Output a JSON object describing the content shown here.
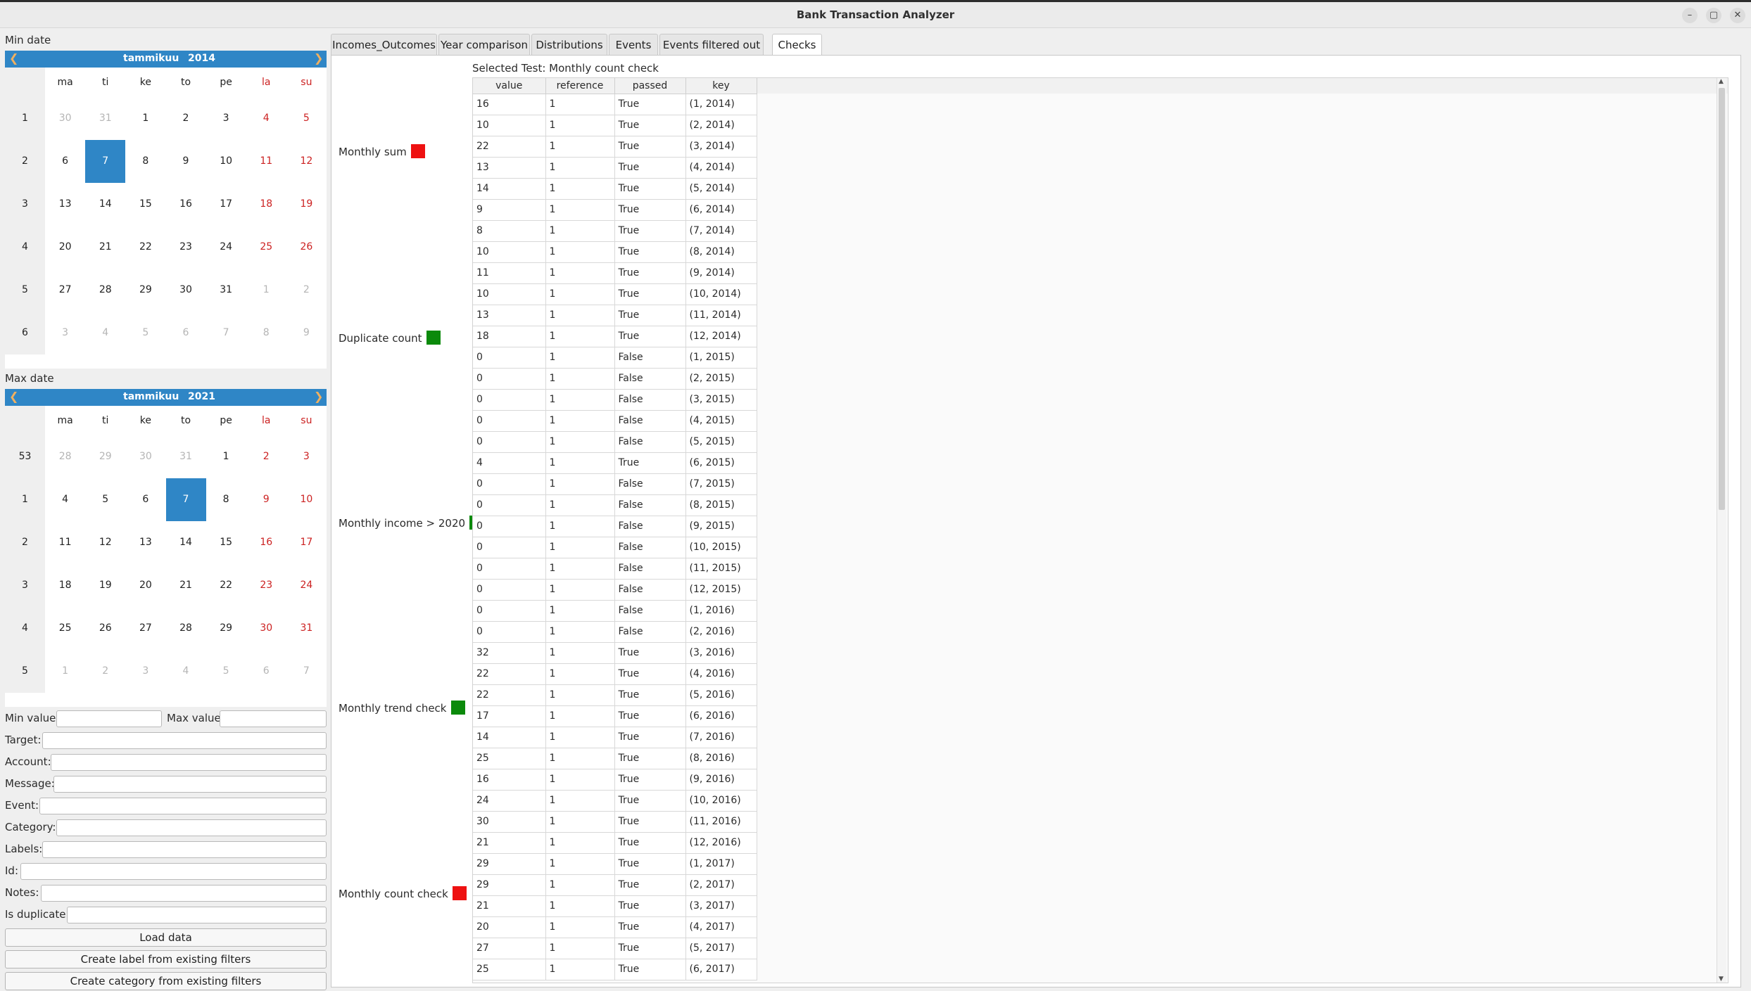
{
  "window": {
    "title": "Bank Transaction Analyzer",
    "minimize": "–",
    "maximize": "▢",
    "close": "✕"
  },
  "min_date": {
    "label": "Min date",
    "month": "tammikuu",
    "year": "2014",
    "day_headers": [
      "ma",
      "ti",
      "ke",
      "to",
      "pe",
      "la",
      "su"
    ],
    "weeks": [
      "1",
      "2",
      "3",
      "4",
      "5",
      "6"
    ],
    "days": [
      [
        "30",
        "31",
        "1",
        "2",
        "3",
        "4",
        "5"
      ],
      [
        "6",
        "7",
        "8",
        "9",
        "10",
        "11",
        "12"
      ],
      [
        "13",
        "14",
        "15",
        "16",
        "17",
        "18",
        "19"
      ],
      [
        "20",
        "21",
        "22",
        "23",
        "24",
        "25",
        "26"
      ],
      [
        "27",
        "28",
        "29",
        "30",
        "31",
        "1",
        "2"
      ],
      [
        "3",
        "4",
        "5",
        "6",
        "7",
        "8",
        "9"
      ]
    ]
  },
  "max_date": {
    "label": "Max date",
    "month": "tammikuu",
    "year": "2021",
    "day_headers": [
      "ma",
      "ti",
      "ke",
      "to",
      "pe",
      "la",
      "su"
    ],
    "weeks": [
      "53",
      "1",
      "2",
      "3",
      "4",
      "5"
    ],
    "days": [
      [
        "28",
        "29",
        "30",
        "31",
        "1",
        "2",
        "3"
      ],
      [
        "4",
        "5",
        "6",
        "7",
        "8",
        "9",
        "10"
      ],
      [
        "11",
        "12",
        "13",
        "14",
        "15",
        "16",
        "17"
      ],
      [
        "18",
        "19",
        "20",
        "21",
        "22",
        "23",
        "24"
      ],
      [
        "25",
        "26",
        "27",
        "28",
        "29",
        "30",
        "31"
      ],
      [
        "1",
        "2",
        "3",
        "4",
        "5",
        "6",
        "7"
      ]
    ]
  },
  "filters": {
    "min_value": "Min value",
    "max_value": "Max value",
    "target": "Target:",
    "account": "Account:",
    "message": "Message:",
    "event": "Event:",
    "category": "Category:",
    "labels": "Labels:",
    "id": "Id:",
    "notes": "Notes:",
    "is_duplicate": "Is duplicate:"
  },
  "buttons": {
    "load": "Load data",
    "create_label": "Create label from existing filters",
    "create_category": "Create category from existing filters"
  },
  "tabs": [
    "Incomes_Outcomes",
    "Year comparison",
    "Distributions",
    "Events",
    "Events filtered out",
    "Checks"
  ],
  "checks": [
    {
      "label": "Monthly sum",
      "color": "#ee1111"
    },
    {
      "label": "Duplicate count",
      "color": "#0b8a0b"
    },
    {
      "label": "Monthly income > 2020",
      "color": "#0b8a0b"
    },
    {
      "label": "Monthly trend check",
      "color": "#0b8a0b"
    },
    {
      "label": "Monthly count check",
      "color": "#ee1111"
    }
  ],
  "selected_test": "Selected Test: Monthly count check",
  "table": {
    "columns": [
      "value",
      "reference",
      "passed",
      "key"
    ],
    "rows": [
      [
        "16",
        "1",
        "True",
        "(1, 2014)"
      ],
      [
        "10",
        "1",
        "True",
        "(2, 2014)"
      ],
      [
        "22",
        "1",
        "True",
        "(3, 2014)"
      ],
      [
        "13",
        "1",
        "True",
        "(4, 2014)"
      ],
      [
        "14",
        "1",
        "True",
        "(5, 2014)"
      ],
      [
        "9",
        "1",
        "True",
        "(6, 2014)"
      ],
      [
        "8",
        "1",
        "True",
        "(7, 2014)"
      ],
      [
        "10",
        "1",
        "True",
        "(8, 2014)"
      ],
      [
        "11",
        "1",
        "True",
        "(9, 2014)"
      ],
      [
        "10",
        "1",
        "True",
        "(10, 2014)"
      ],
      [
        "13",
        "1",
        "True",
        "(11, 2014)"
      ],
      [
        "18",
        "1",
        "True",
        "(12, 2014)"
      ],
      [
        "0",
        "1",
        "False",
        "(1, 2015)"
      ],
      [
        "0",
        "1",
        "False",
        "(2, 2015)"
      ],
      [
        "0",
        "1",
        "False",
        "(3, 2015)"
      ],
      [
        "0",
        "1",
        "False",
        "(4, 2015)"
      ],
      [
        "0",
        "1",
        "False",
        "(5, 2015)"
      ],
      [
        "4",
        "1",
        "True",
        "(6, 2015)"
      ],
      [
        "0",
        "1",
        "False",
        "(7, 2015)"
      ],
      [
        "0",
        "1",
        "False",
        "(8, 2015)"
      ],
      [
        "0",
        "1",
        "False",
        "(9, 2015)"
      ],
      [
        "0",
        "1",
        "False",
        "(10, 2015)"
      ],
      [
        "0",
        "1",
        "False",
        "(11, 2015)"
      ],
      [
        "0",
        "1",
        "False",
        "(12, 2015)"
      ],
      [
        "0",
        "1",
        "False",
        "(1, 2016)"
      ],
      [
        "0",
        "1",
        "False",
        "(2, 2016)"
      ],
      [
        "32",
        "1",
        "True",
        "(3, 2016)"
      ],
      [
        "22",
        "1",
        "True",
        "(4, 2016)"
      ],
      [
        "22",
        "1",
        "True",
        "(5, 2016)"
      ],
      [
        "17",
        "1",
        "True",
        "(6, 2016)"
      ],
      [
        "14",
        "1",
        "True",
        "(7, 2016)"
      ],
      [
        "25",
        "1",
        "True",
        "(8, 2016)"
      ],
      [
        "16",
        "1",
        "True",
        "(9, 2016)"
      ],
      [
        "24",
        "1",
        "True",
        "(10, 2016)"
      ],
      [
        "30",
        "1",
        "True",
        "(11, 2016)"
      ],
      [
        "21",
        "1",
        "True",
        "(12, 2016)"
      ],
      [
        "29",
        "1",
        "True",
        "(1, 2017)"
      ],
      [
        "29",
        "1",
        "True",
        "(2, 2017)"
      ],
      [
        "21",
        "1",
        "True",
        "(3, 2017)"
      ],
      [
        "20",
        "1",
        "True",
        "(4, 2017)"
      ],
      [
        "27",
        "1",
        "True",
        "(5, 2017)"
      ],
      [
        "25",
        "1",
        "True",
        "(6, 2017)"
      ]
    ]
  }
}
